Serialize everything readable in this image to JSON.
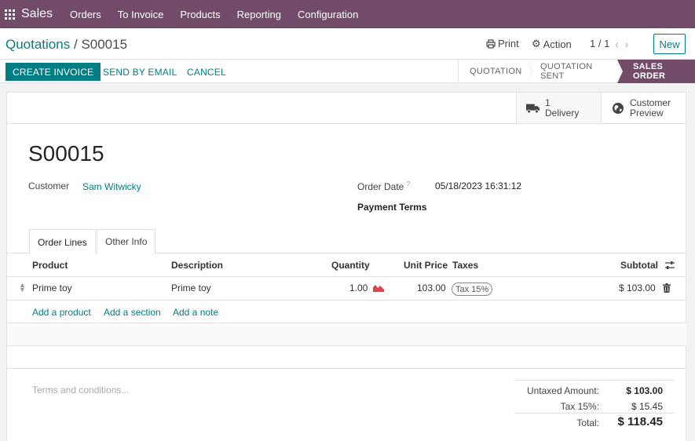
{
  "app": {
    "name": "Sales",
    "menu": [
      "Orders",
      "To Invoice",
      "Products",
      "Reporting",
      "Configuration"
    ]
  },
  "control_panel": {
    "breadcrumb_parent": "Quotations",
    "breadcrumb_sep": "/",
    "breadcrumb_current": "S00015",
    "print_label": "Print",
    "action_label": "Action",
    "pager": "1 / 1",
    "new_label": "New"
  },
  "statusbar": {
    "create_invoice": "CREATE INVOICE",
    "send_by_email": "SEND BY EMAIL",
    "cancel": "CANCEL",
    "stages": [
      "QUOTATION",
      "QUOTATION SENT",
      "SALES ORDER"
    ],
    "active_stage": "SALES ORDER"
  },
  "smart_buttons": {
    "delivery_count": "1",
    "delivery_label": "Delivery",
    "preview_line1": "Customer",
    "preview_line2": "Preview"
  },
  "record": {
    "name": "S00015",
    "customer_label": "Customer",
    "customer_value": "Sam Witwicky",
    "order_date_label": "Order Date",
    "order_date_help": "?",
    "order_date_value": "05/18/2023 16:31:12",
    "payment_terms_label": "Payment Terms"
  },
  "tabs": [
    "Order Lines",
    "Other Info"
  ],
  "order_lines": {
    "headers": {
      "product": "Product",
      "description": "Description",
      "quantity": "Quantity",
      "unit_price": "Unit Price",
      "taxes": "Taxes",
      "subtotal": "Subtotal"
    },
    "rows": [
      {
        "product": "Prime toy",
        "description": "Prime toy",
        "quantity": "1.00",
        "unit_price": "103.00",
        "tax": "Tax 15%",
        "subtotal": "$ 103.00"
      }
    ],
    "add_product": "Add a product",
    "add_section": "Add a section",
    "add_note": "Add a note"
  },
  "terms_placeholder": "Terms and conditions...",
  "totals": {
    "untaxed_label": "Untaxed Amount:",
    "untaxed_value": "$ 103.00",
    "tax_label": "Tax 15%:",
    "tax_value": "$ 15.45",
    "total_label": "Total:",
    "total_value": "$ 118.45"
  },
  "colors": {
    "brand": "#714b67",
    "accent": "#017e84"
  }
}
